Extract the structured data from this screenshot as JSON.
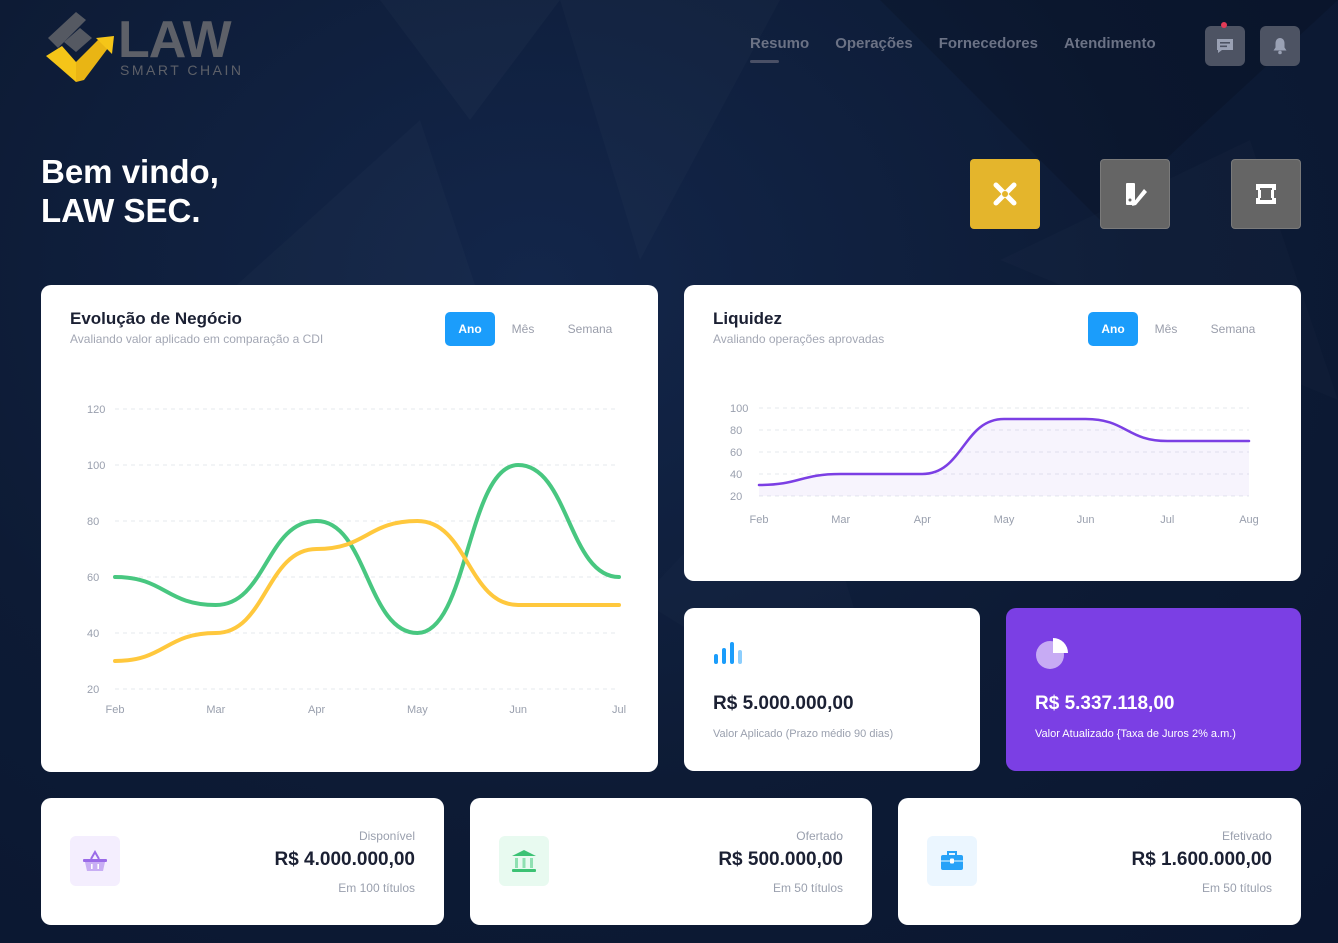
{
  "brand": {
    "name": "LAW",
    "tagline": "SMART CHAIN"
  },
  "nav": [
    {
      "label": "Resumo",
      "active": true
    },
    {
      "label": "Operações",
      "active": false
    },
    {
      "label": "Fornecedores",
      "active": false
    },
    {
      "label": "Atendimento",
      "active": false
    }
  ],
  "header_icons": [
    "chat-icon",
    "bell-icon"
  ],
  "welcome": {
    "line1": "Bem vindo,",
    "line2": "LAW SEC."
  },
  "quick_actions": [
    {
      "icon": "close-x-icon",
      "color": "#e4b52c"
    },
    {
      "icon": "edit-document-icon",
      "color": "#656565"
    },
    {
      "icon": "frame-icon",
      "color": "#656565"
    }
  ],
  "evolucao": {
    "title": "Evolução de Negócio",
    "subtitle": "Avaliando valor aplicado em comparação a CDI",
    "tabs": [
      "Ano",
      "Mês",
      "Semana"
    ],
    "active_tab": "Ano"
  },
  "liquidez": {
    "title": "Liquidez",
    "subtitle": "Avaliando operações aprovadas",
    "tabs": [
      "Ano",
      "Mês",
      "Semana"
    ],
    "active_tab": "Ano"
  },
  "chart_data": [
    {
      "type": "line",
      "title": "Evolução de Negócio",
      "categories": [
        "Feb",
        "Mar",
        "Apr",
        "May",
        "Jun",
        "Jul"
      ],
      "ylim": [
        20,
        120
      ],
      "yticks": [
        20,
        40,
        60,
        80,
        100,
        120
      ],
      "grid": true,
      "series": [
        {
          "values": [
            60,
            50,
            80,
            40,
            100,
            60
          ],
          "color": "#48c780"
        },
        {
          "values": [
            30,
            40,
            70,
            80,
            50,
            50
          ],
          "color": "#ffc83d"
        }
      ]
    },
    {
      "type": "area",
      "title": "Liquidez",
      "categories": [
        "Feb",
        "Mar",
        "Apr",
        "May",
        "Jun",
        "Jul",
        "Aug"
      ],
      "ylim": [
        20,
        100
      ],
      "yticks": [
        20,
        40,
        60,
        80,
        100
      ],
      "grid": true,
      "series": [
        {
          "values": [
            30,
            40,
            40,
            90,
            90,
            70,
            70
          ],
          "color": "#7b3fe4"
        }
      ]
    }
  ],
  "stats": [
    {
      "amount": "R$ 5.000.000,00",
      "desc": "Valor Aplicado (Prazo médio 90 dias)",
      "icon": "bar-chart-icon"
    },
    {
      "amount": "R$ 5.337.118,00",
      "desc": "Valor Atualizado {Taxa de Juros 2% a.m.)",
      "icon": "pie-chart-icon",
      "bg": "#7b3fe4"
    }
  ],
  "summary": [
    {
      "label": "Disponível",
      "value": "R$ 4.000.000,00",
      "count": "Em 100 títulos",
      "icon": "basket-icon",
      "icon_bg": "#f4eefe",
      "icon_color": "#9a6be8"
    },
    {
      "label": "Ofertado",
      "value": "R$ 500.000,00",
      "count": "Em 50 títulos",
      "icon": "bank-icon",
      "icon_bg": "#e8faf0",
      "icon_color": "#3cc274"
    },
    {
      "label": "Efetivado",
      "value": "R$ 1.600.000,00",
      "count": "Em 50 títulos",
      "icon": "briefcase-icon",
      "icon_bg": "#ebf6ff",
      "icon_color": "#27a2f8"
    }
  ]
}
